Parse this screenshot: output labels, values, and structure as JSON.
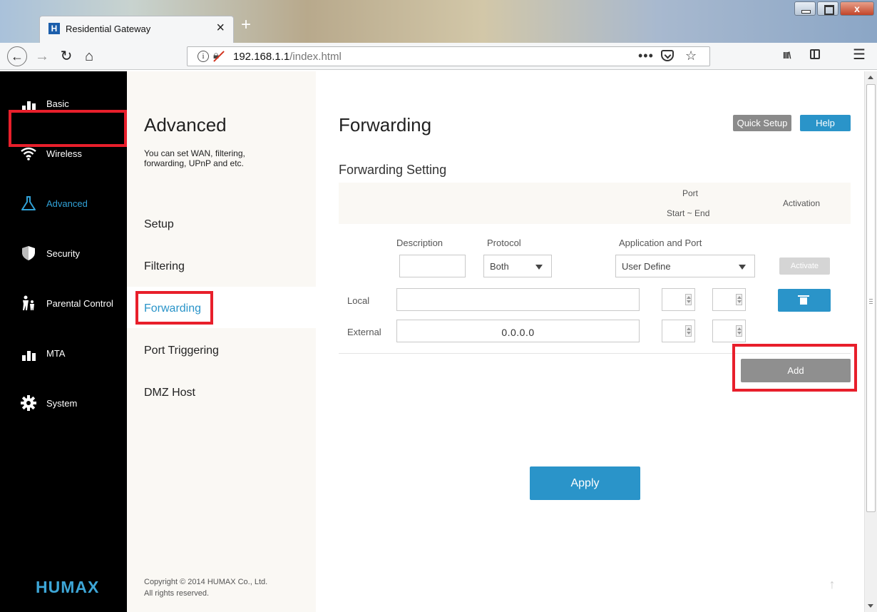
{
  "browser": {
    "tab_title": "Residential Gateway",
    "tab_favicon": "H",
    "new_tab": "+",
    "url_host": "192.168.1.1",
    "url_path": "/index.html",
    "more": "•••",
    "menu": "☰",
    "library": "III\\"
  },
  "left_nav": {
    "items": [
      {
        "label": "Basic",
        "icon": "bar-chart-icon"
      },
      {
        "label": "Wireless",
        "icon": "wifi-icon"
      },
      {
        "label": "Advanced",
        "icon": "flask-icon"
      },
      {
        "label": "Security",
        "icon": "shield-icon"
      },
      {
        "label": "Parental Control",
        "icon": "parent-child-icon"
      },
      {
        "label": "MTA",
        "icon": "bar-chart-icon"
      },
      {
        "label": "System",
        "icon": "gear-icon"
      }
    ],
    "active": "Advanced",
    "logo": "HUMAX"
  },
  "sub_nav": {
    "title": "Advanced",
    "description": "You can set WAN, filtering, forwarding, UPnP and etc.",
    "items": [
      "Setup",
      "Filtering",
      "Forwarding",
      "Port Triggering",
      "DMZ Host"
    ],
    "active": "Forwarding",
    "copyright_line1": "Copyright © 2014 HUMAX Co., Ltd.",
    "copyright_line2": "All rights reserved."
  },
  "main": {
    "title": "Forwarding",
    "quick_setup_label": "Quick Setup",
    "help_label": "Help",
    "section_title": "Forwarding Setting",
    "table_header": {
      "port": "Port",
      "range": "Start ~ End",
      "activation": "Activation"
    },
    "columns": {
      "description": "Description",
      "protocol": "Protocol",
      "application": "Application and Port"
    },
    "protocol_value": "Both",
    "application_value": "User Define",
    "activate_label": "Activate",
    "local_label": "Local",
    "external_label": "External",
    "external_ip": "0.0.0.0",
    "add_label": "Add",
    "apply_label": "Apply"
  },
  "colors": {
    "accent": "#2a94c9",
    "highlight_box": "#e81f2b",
    "sidebar_bg": "#000000",
    "logo": "#3da6d7"
  }
}
